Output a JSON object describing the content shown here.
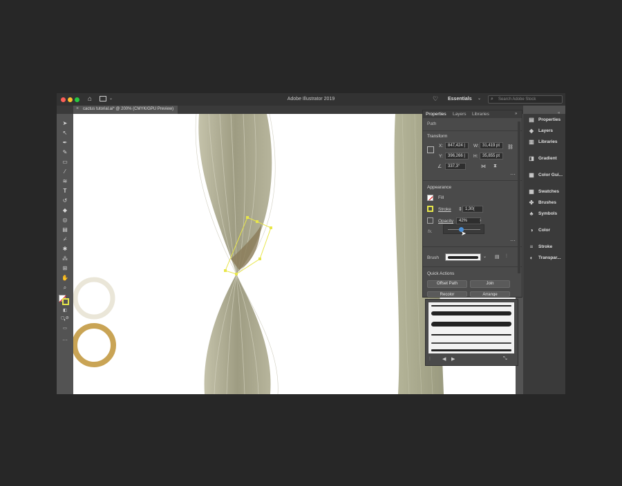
{
  "window": {
    "title": "Adobe Illustrator 2019",
    "workspace": "Essentials",
    "search_placeholder": "Search Adobe Stock"
  },
  "document_tab": {
    "close": "×",
    "label": "cactus tutorial.ai* @ 200% (CMYK/GPU Preview)"
  },
  "right_dock": {
    "items": [
      {
        "label": "Properties",
        "icon": "properties-icon"
      },
      {
        "label": "Layers",
        "icon": "layers-icon"
      },
      {
        "label": "Libraries",
        "icon": "libraries-icon"
      },
      {
        "label": "Gradient",
        "icon": "gradient-icon"
      },
      {
        "label": "Color Gui...",
        "icon": "color-guide-icon"
      },
      {
        "label": "Swatches",
        "icon": "swatches-icon"
      },
      {
        "label": "Brushes",
        "icon": "brushes-icon"
      },
      {
        "label": "Symbols",
        "icon": "symbols-icon"
      },
      {
        "label": "Color",
        "icon": "color-icon"
      },
      {
        "label": "Stroke",
        "icon": "stroke-icon"
      },
      {
        "label": "Transpar...",
        "icon": "transparency-icon"
      }
    ]
  },
  "properties_panel": {
    "tabs": [
      "Properties",
      "Layers",
      "Libraries"
    ],
    "selection_type": "Path",
    "transform": {
      "heading": "Transform",
      "x_label": "X:",
      "x": "847,424 |",
      "y_label": "Y:",
      "y": "396,266 |",
      "w_label": "W:",
      "w": "31,419 pt",
      "h_label": "H:",
      "h": "35,855 pt",
      "angle": "337,3°"
    },
    "appearance": {
      "heading": "Appearance",
      "fill_label": "Fill",
      "stroke_label": "Stroke",
      "stroke_value": "1,30(",
      "opacity_label": "Opacity",
      "opacity_value": "42%",
      "opacity_level": 0.42,
      "fx_label": "fx."
    },
    "brush_label": "Brush",
    "quick_actions": {
      "heading": "Quick Actions",
      "buttons": [
        "Offset Path",
        "Join",
        "Recolor",
        "Arrange"
      ]
    }
  },
  "colors": {
    "cactus": "#a8a68c",
    "selection": "#e8e64a",
    "ring_light": "#eae6d8",
    "ring_gold": "#c9a455",
    "accent": "#4a90d9"
  }
}
